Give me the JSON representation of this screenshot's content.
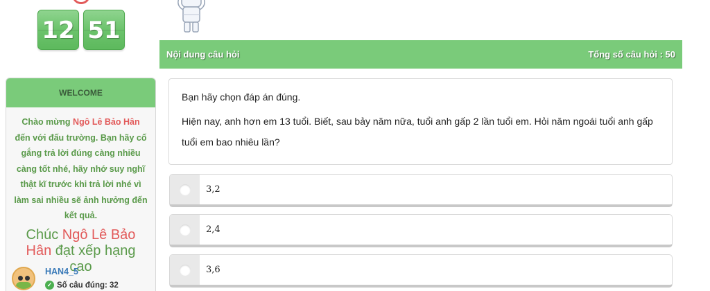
{
  "timer": {
    "minutes": "12",
    "seconds": "51"
  },
  "header": {
    "title": "Nội dung câu hỏi",
    "total": "Tổng số câu hỏi : 50"
  },
  "welcome": {
    "title": "WELCOME",
    "msg_prefix": "Chào mừng ",
    "name": "Ngô Lê Bảo Hân",
    "msg_suffix": " đến với đấu trường. Bạn hãy cố gắng trả lời đúng càng nhiều càng tốt nhé, hãy nhớ suy nghĩ thật kĩ trước khi trả lời nhé vì làm sai nhiều sẽ ảnh hưởng đến kết quả.",
    "wish_prefix": "Chúc ",
    "wish_suffix": " đạt xếp hạng cao"
  },
  "user": {
    "username": "HAN4_5",
    "correct_label": "Số câu đúng: 32"
  },
  "question": {
    "instruction": "Bạn hãy chọn đáp án đúng.",
    "text": "Hiện nay, anh hơn em 13 tuổi. Biết, sau bảy năm nữa, tuổi anh gấp 2 lần tuổi em. Hỏi năm ngoái tuổi anh gấp tuổi em bao nhiêu lần?"
  },
  "answers": [
    {
      "label": "3,2"
    },
    {
      "label": "2,4"
    },
    {
      "label": "3,6"
    }
  ],
  "colors": {
    "accent_green": "#7acb7a",
    "highlight_red": "#e25a5a",
    "text_green": "#5a9a4a"
  }
}
